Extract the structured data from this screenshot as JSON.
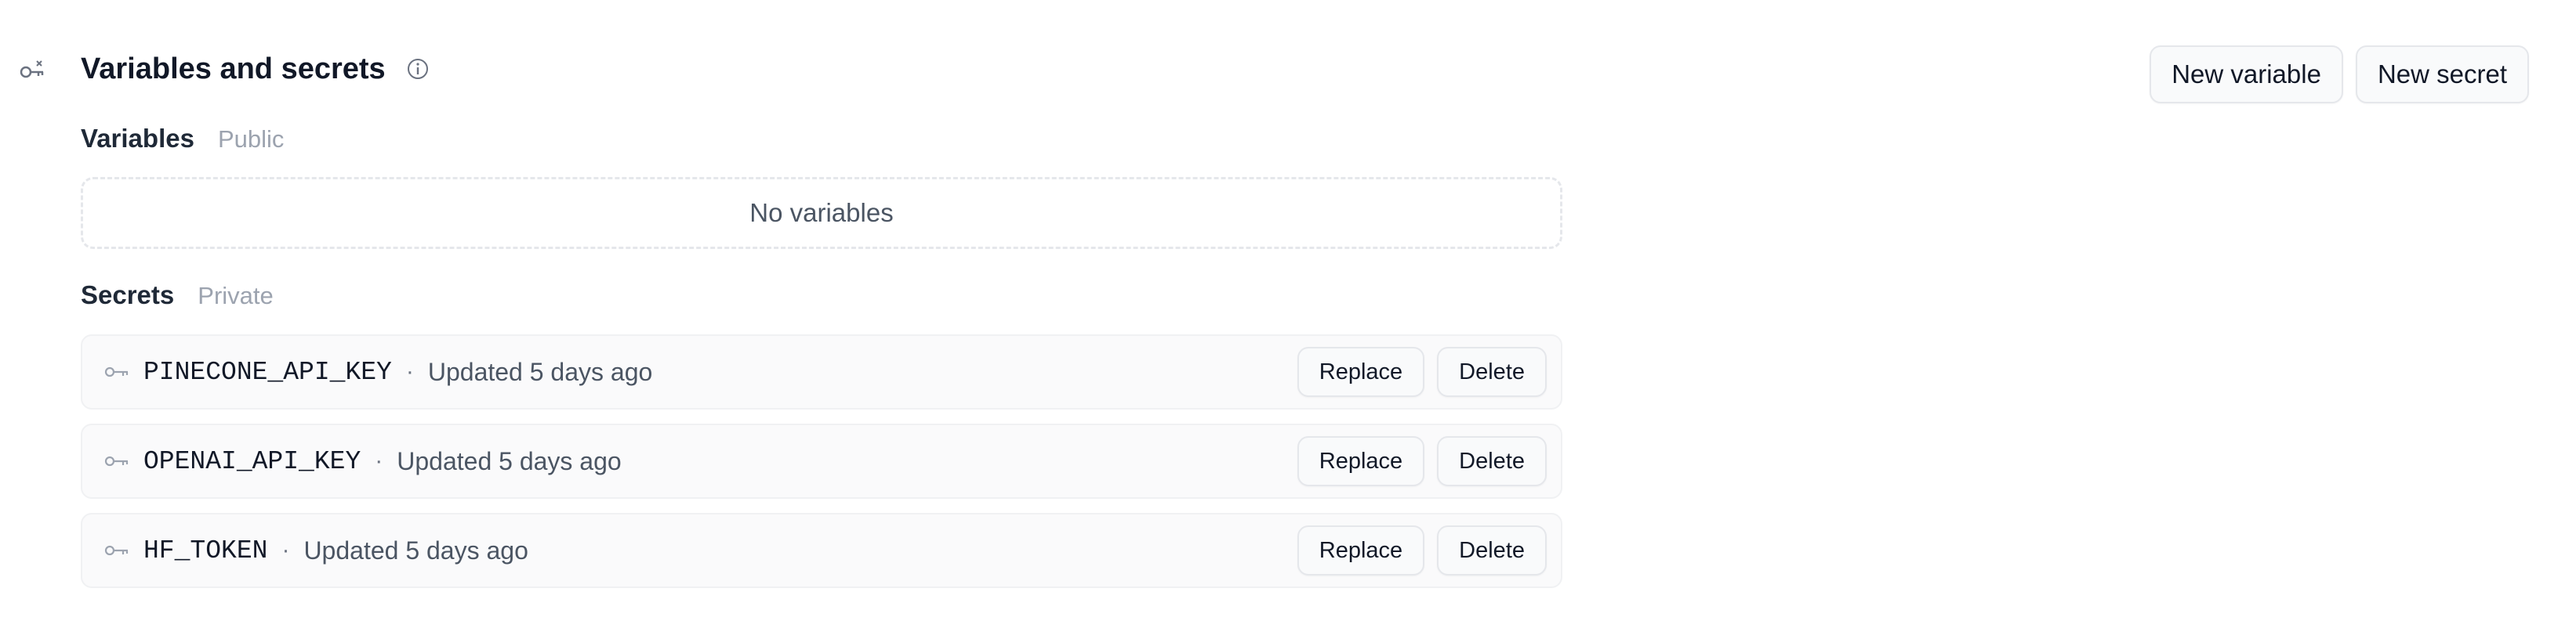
{
  "section": {
    "title": "Variables and secrets",
    "icon": "key-settings-icon",
    "info_icon": "info-icon"
  },
  "actions": {
    "new_variable": "New variable",
    "new_secret": "New secret"
  },
  "variables": {
    "label": "Variables",
    "visibility": "Public",
    "empty_text": "No variables",
    "items": []
  },
  "secrets": {
    "label": "Secrets",
    "visibility": "Private",
    "separator": "·",
    "items": [
      {
        "name": "PINECONE_API_KEY",
        "updated": "Updated 5 days ago",
        "replace": "Replace",
        "delete": "Delete"
      },
      {
        "name": "OPENAI_API_KEY",
        "updated": "Updated 5 days ago",
        "replace": "Replace",
        "delete": "Delete"
      },
      {
        "name": "HF_TOKEN",
        "updated": "Updated 5 days ago",
        "replace": "Replace",
        "delete": "Delete"
      }
    ]
  },
  "colors": {
    "text": "#111827",
    "muted": "#9ca3af",
    "border": "#e5e7eb",
    "row_bg": "#fafafb"
  }
}
